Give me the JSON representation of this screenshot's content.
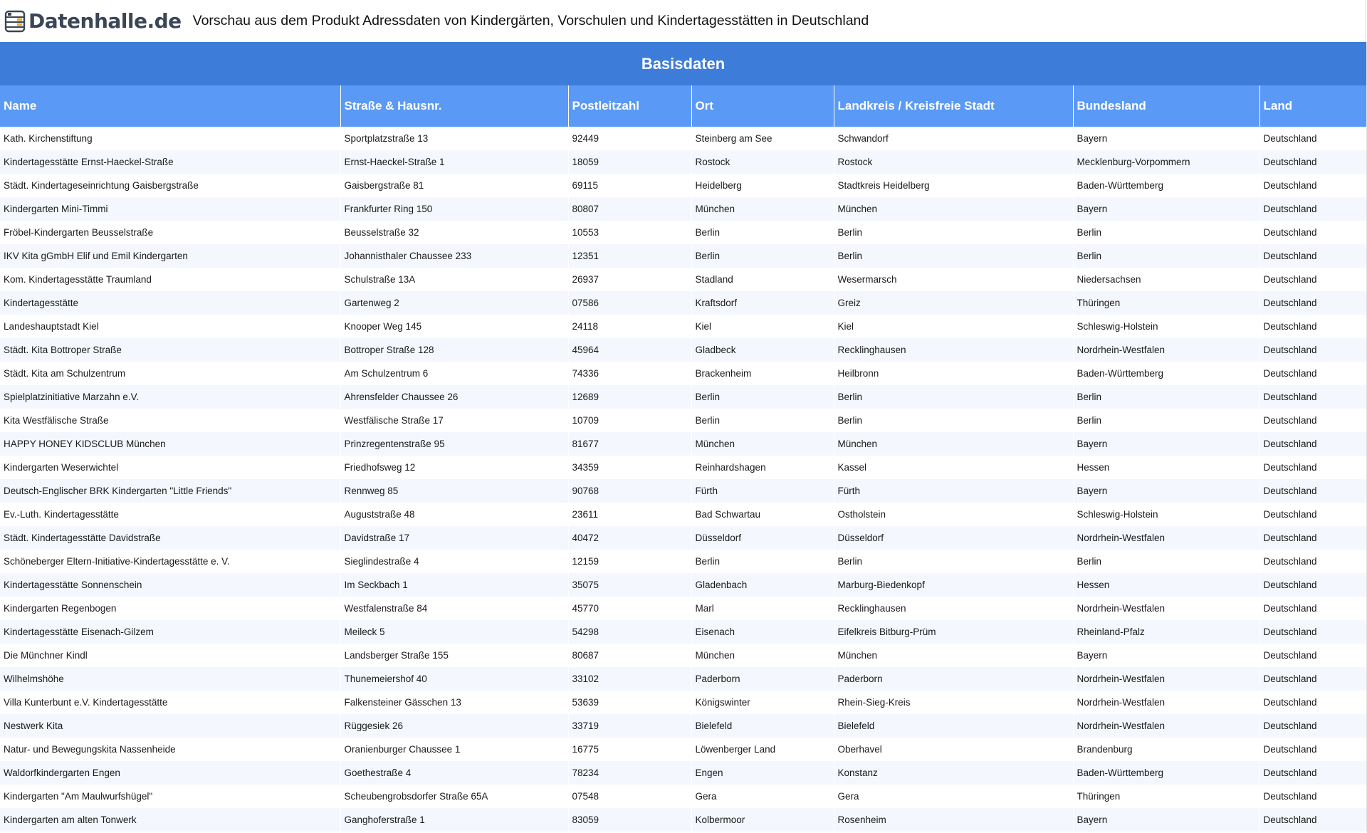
{
  "header": {
    "logo_text": "Datenhalle.de",
    "title": "Vorschau aus dem Produkt Adressdaten von Kindergärten, Vorschulen und Kindertagesstätten in Deutschland"
  },
  "table": {
    "section_title": "Basisdaten",
    "columns": [
      "Name",
      "Straße & Hausnr.",
      "Postleitzahl",
      "Ort",
      "Landkreis / Kreisfreie Stadt",
      "Bundesland",
      "Land"
    ],
    "rows": [
      [
        "Kath. Kirchenstiftung",
        "Sportplatzstraße 13",
        "92449",
        "Steinberg am See",
        "Schwandorf",
        "Bayern",
        "Deutschland"
      ],
      [
        "Kindertagesstätte Ernst-Haeckel-Straße",
        "Ernst-Haeckel-Straße 1",
        "18059",
        "Rostock",
        "Rostock",
        "Mecklenburg-Vorpommern",
        "Deutschland"
      ],
      [
        "Städt. Kindertageseinrichtung Gaisbergstraße",
        "Gaisbergstraße 81",
        "69115",
        "Heidelberg",
        "Stadtkreis Heidelberg",
        "Baden-Württemberg",
        "Deutschland"
      ],
      [
        "Kindergarten Mini-Timmi",
        "Frankfurter Ring 150",
        "80807",
        "München",
        "München",
        "Bayern",
        "Deutschland"
      ],
      [
        "Fröbel-Kindergarten Beusselstraße",
        "Beusselstraße 32",
        "10553",
        "Berlin",
        "Berlin",
        "Berlin",
        "Deutschland"
      ],
      [
        "IKV Kita gGmbH Elif und Emil Kindergarten",
        "Johannisthaler Chaussee 233",
        "12351",
        "Berlin",
        "Berlin",
        "Berlin",
        "Deutschland"
      ],
      [
        "Kom. Kindertagesstätte Traumland",
        "Schulstraße 13A",
        "26937",
        "Stadland",
        "Wesermarsch",
        "Niedersachsen",
        "Deutschland"
      ],
      [
        "Kindertagesstätte",
        "Gartenweg 2",
        "07586",
        "Kraftsdorf",
        "Greiz",
        "Thüringen",
        "Deutschland"
      ],
      [
        "Landeshauptstadt Kiel",
        "Knooper Weg 145",
        "24118",
        "Kiel",
        "Kiel",
        "Schleswig-Holstein",
        "Deutschland"
      ],
      [
        "Städt. Kita Bottroper Straße",
        "Bottroper Straße 128",
        "45964",
        "Gladbeck",
        "Recklinghausen",
        "Nordrhein-Westfalen",
        "Deutschland"
      ],
      [
        "Städt. Kita am Schulzentrum",
        "Am Schulzentrum 6",
        "74336",
        "Brackenheim",
        "Heilbronn",
        "Baden-Württemberg",
        "Deutschland"
      ],
      [
        "Spielplatzinitiative Marzahn e.V.",
        "Ahrensfelder Chaussee 26",
        "12689",
        "Berlin",
        "Berlin",
        "Berlin",
        "Deutschland"
      ],
      [
        "Kita Westfälische Straße",
        "Westfälische Straße 17",
        "10709",
        "Berlin",
        "Berlin",
        "Berlin",
        "Deutschland"
      ],
      [
        "HAPPY HONEY KIDSCLUB München",
        "Prinzregentenstraße 95",
        "81677",
        "München",
        "München",
        "Bayern",
        "Deutschland"
      ],
      [
        "Kindergarten Weserwichtel",
        "Friedhofsweg 12",
        "34359",
        "Reinhardshagen",
        "Kassel",
        "Hessen",
        "Deutschland"
      ],
      [
        "Deutsch-Englischer BRK Kindergarten \"Little Friends\"",
        "Rennweg 85",
        "90768",
        "Fürth",
        "Fürth",
        "Bayern",
        "Deutschland"
      ],
      [
        "Ev.-Luth. Kindertagesstätte",
        "Auguststraße 48",
        "23611",
        "Bad Schwartau",
        "Ostholstein",
        "Schleswig-Holstein",
        "Deutschland"
      ],
      [
        "Städt. Kindertagesstätte Davidstraße",
        "Davidstraße 17",
        "40472",
        "Düsseldorf",
        "Düsseldorf",
        "Nordrhein-Westfalen",
        "Deutschland"
      ],
      [
        "Schöneberger Eltern-Initiative-Kindertagesstätte e. V.",
        "Sieglindestraße 4",
        "12159",
        "Berlin",
        "Berlin",
        "Berlin",
        "Deutschland"
      ],
      [
        "Kindertagesstätte Sonnenschein",
        "Im Seckbach 1",
        "35075",
        "Gladenbach",
        "Marburg-Biedenkopf",
        "Hessen",
        "Deutschland"
      ],
      [
        "Kindergarten Regenbogen",
        "Westfalenstraße 84",
        "45770",
        "Marl",
        "Recklinghausen",
        "Nordrhein-Westfalen",
        "Deutschland"
      ],
      [
        "Kindertagesstätte Eisenach-Gilzem",
        "Meileck 5",
        "54298",
        "Eisenach",
        "Eifelkreis Bitburg-Prüm",
        "Rheinland-Pfalz",
        "Deutschland"
      ],
      [
        "Die Münchner Kindl",
        "Landsberger Straße 155",
        "80687",
        "München",
        "München",
        "Bayern",
        "Deutschland"
      ],
      [
        "Wilhelmshöhe",
        "Thunemeiershof 40",
        "33102",
        "Paderborn",
        "Paderborn",
        "Nordrhein-Westfalen",
        "Deutschland"
      ],
      [
        "Villa Kunterbunt e.V. Kindertagesstätte",
        "Falkensteiner Gässchen 13",
        "53639",
        "Königswinter",
        "Rhein-Sieg-Kreis",
        "Nordrhein-Westfalen",
        "Deutschland"
      ],
      [
        "Nestwerk Kita",
        "Rüggesiek 26",
        "33719",
        "Bielefeld",
        "Bielefeld",
        "Nordrhein-Westfalen",
        "Deutschland"
      ],
      [
        "Natur- und Bewegungskita Nassenheide",
        "Oranienburger Chaussee 1",
        "16775",
        "Löwenberger Land",
        "Oberhavel",
        "Brandenburg",
        "Deutschland"
      ],
      [
        "Waldorfkindergarten Engen",
        "Goethestraße 4",
        "78234",
        "Engen",
        "Konstanz",
        "Baden-Württemberg",
        "Deutschland"
      ],
      [
        "Kindergarten \"Am Maulwurfshügel\"",
        "Scheubengrobsdorfer Straße 65A",
        "07548",
        "Gera",
        "Gera",
        "Thüringen",
        "Deutschland"
      ],
      [
        "Kindergarten am alten Tonwerk",
        "Ganghoferstraße 1",
        "83059",
        "Kolbermoor",
        "Rosenheim",
        "Bayern",
        "Deutschland"
      ]
    ]
  }
}
